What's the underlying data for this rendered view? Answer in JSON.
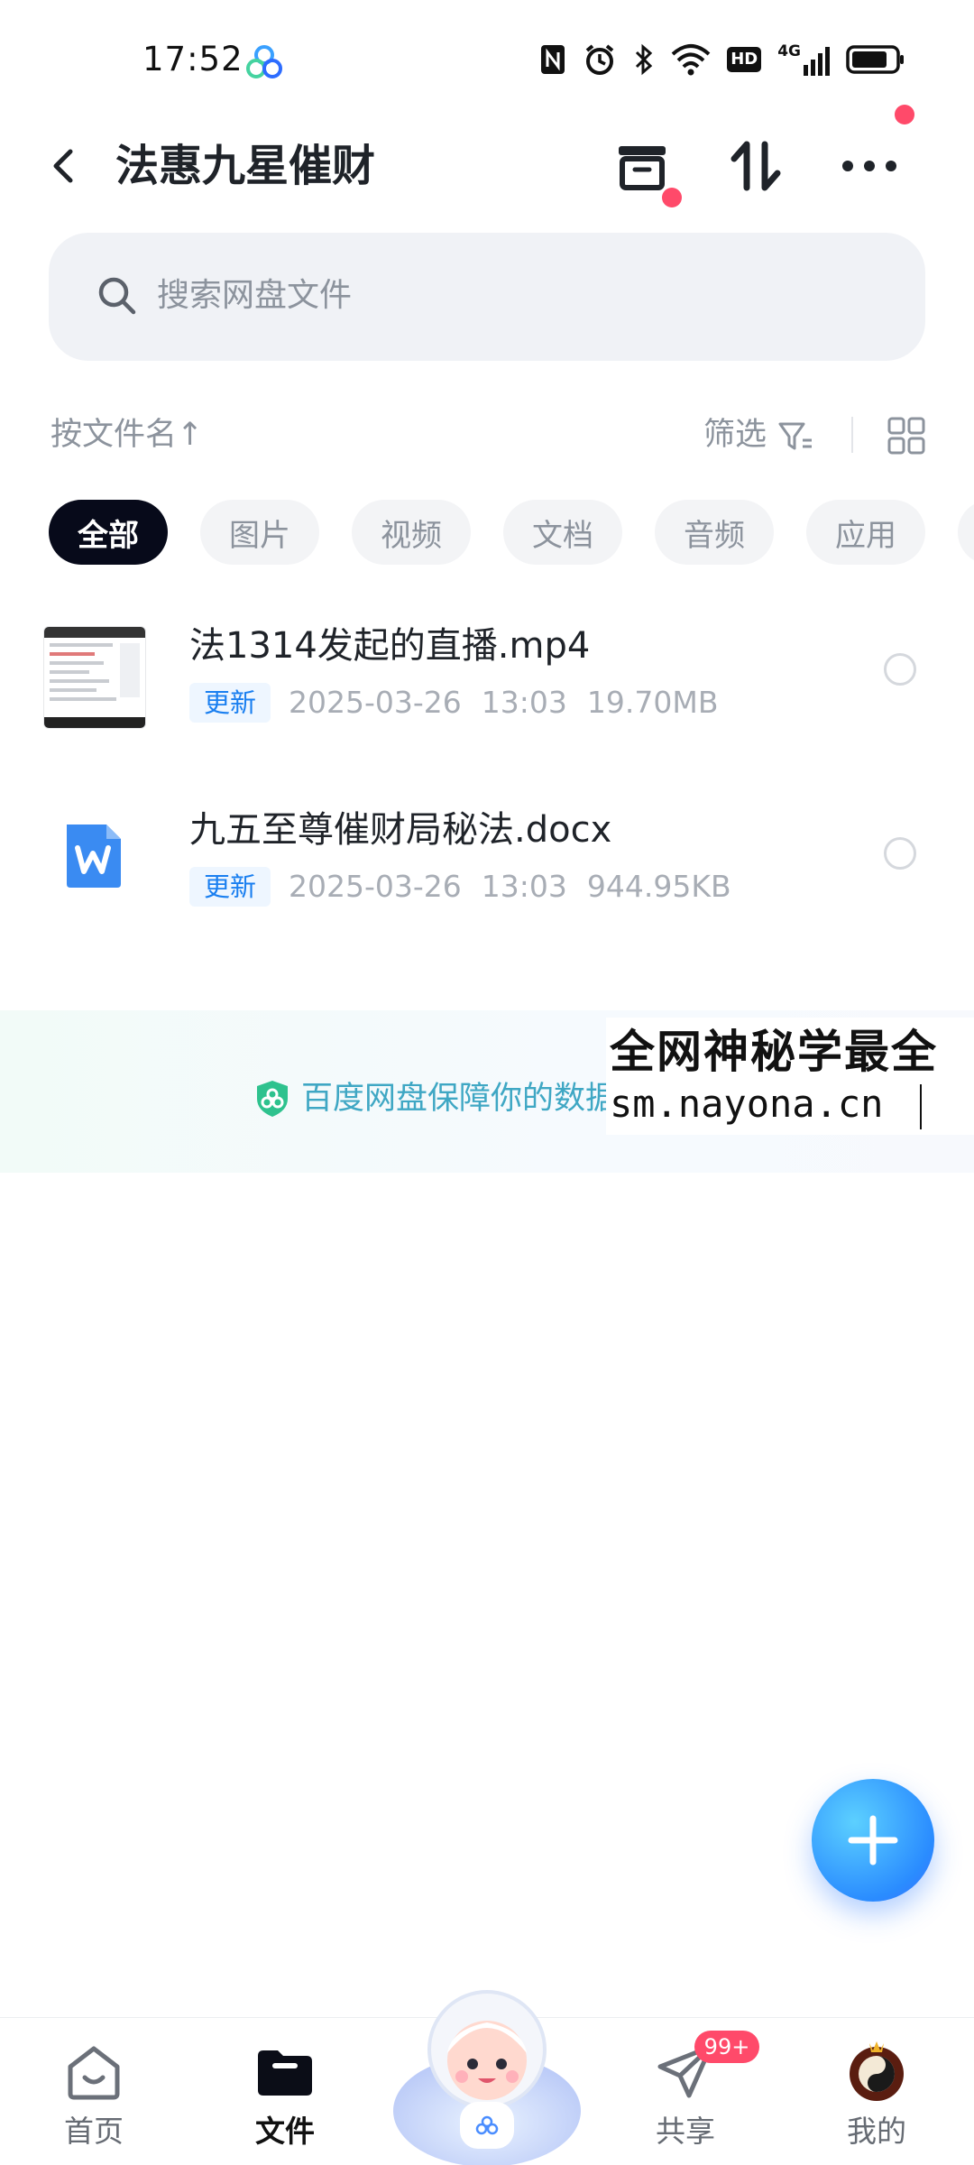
{
  "status_bar": {
    "time": "17:52",
    "app_icon": "baidu-netdisk-icon",
    "icons": [
      "nfc-icon",
      "alarm-icon",
      "bluetooth-icon",
      "wifi-icon",
      "hd-icon",
      "signal-4g-icon",
      "battery-icon"
    ],
    "hd_label": "HD",
    "network_label": "4G"
  },
  "header": {
    "title": "法惠九星催财",
    "actions": [
      "archive-icon",
      "sort-icon",
      "more-icon"
    ]
  },
  "search": {
    "placeholder": "搜索网盘文件"
  },
  "sort_bar": {
    "sort_label": "按文件名",
    "sort_arrow": "↑",
    "filter_label": "筛选"
  },
  "categories": [
    {
      "label": "全部",
      "active": true
    },
    {
      "label": "图片",
      "active": false
    },
    {
      "label": "视频",
      "active": false
    },
    {
      "label": "文档",
      "active": false
    },
    {
      "label": "音频",
      "active": false
    },
    {
      "label": "应用",
      "active": false
    }
  ],
  "files": [
    {
      "name": "法1314发起的直播.mp4",
      "badge": "更新",
      "date": "2025-03-26",
      "time": "13:03",
      "size": "19.70MB",
      "icon": "video-thumbnail"
    },
    {
      "name": "九五至尊催财局秘法.docx",
      "badge": "更新",
      "date": "2025-03-26",
      "time": "13:03",
      "size": "944.95KB",
      "icon": "word-doc-icon"
    }
  ],
  "footer": {
    "text": "百度网盘保障你的数据"
  },
  "overlay": {
    "title": "全网神秘学最全",
    "url": "sm.nayona.cn"
  },
  "bottom_nav": [
    {
      "label": "首页",
      "icon": "home-icon",
      "active": false
    },
    {
      "label": "文件",
      "icon": "folder-icon",
      "active": true
    },
    {
      "label": "",
      "icon": "mascot-icon",
      "active": false
    },
    {
      "label": "共享",
      "icon": "share-plane-icon",
      "active": false,
      "badge": "99+"
    },
    {
      "label": "我的",
      "icon": "avatar-icon",
      "active": false
    }
  ],
  "colors": {
    "accent": "#2a8cff",
    "active_chip": "#070a1a",
    "badge_red": "#ff4a6a",
    "update_badge_text": "#1a7ff0",
    "footer_text": "#3fa7c4"
  }
}
